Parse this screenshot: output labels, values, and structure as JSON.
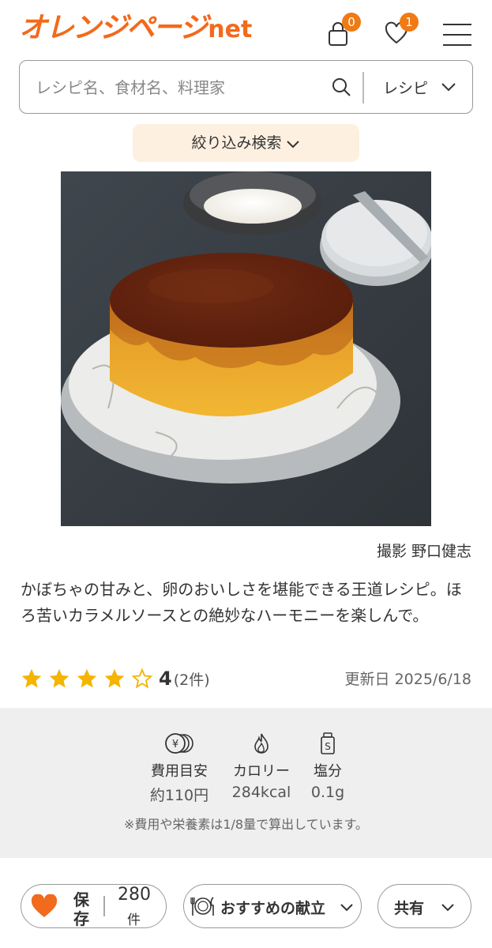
{
  "header": {
    "logo_text": "オレンジページ",
    "logo_suffix": "net",
    "cart_count": "0",
    "favorites_count": "1",
    "brand_color": "#f26a1b",
    "icons": [
      "shopping-bag-icon",
      "heart-icon",
      "hamburger-menu-icon"
    ]
  },
  "search": {
    "placeholder": "レシピ名、食材名、料理家",
    "category": "レシピ"
  },
  "filter": {
    "label": "絞り込み検索"
  },
  "photo": {
    "credit": "撮影 野口健志"
  },
  "recipe": {
    "description": "かぼちゃの甘みと、卵のおいしさを堪能できる王道レシピ。ほろ苦いカラメルソースとの絶妙なハーモニーを楽しんで。",
    "rating_value": 4,
    "rating_score": "4",
    "rating_count": "(2件)",
    "updated": "更新日 2025/6/18",
    "star_color": "#f5b400"
  },
  "nutrition": {
    "items": [
      {
        "label": "費用目安",
        "value": "約110円",
        "icon": "yen-coins-icon"
      },
      {
        "label": "カロリー",
        "value": "284kcal",
        "icon": "flame-icon"
      },
      {
        "label": "塩分",
        "value": "0.1g",
        "icon": "salt-shaker-icon"
      }
    ],
    "note": "※費用や栄養素は1/8量で算出しています。"
  },
  "actions": {
    "save_label_1": "保",
    "save_label_2": "存",
    "save_count": "280",
    "save_unit": "件",
    "recommend_label": "おすすめの献立",
    "share_label": "共有"
  }
}
